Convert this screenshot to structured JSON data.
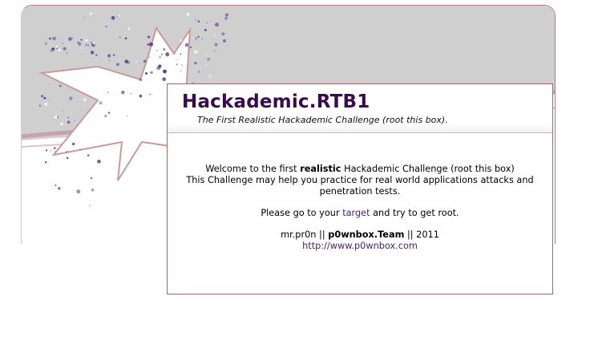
{
  "header": {
    "title": "Hackademic.RTB1",
    "subtitle": "The First Realistic Hackademic Challenge (root this box)."
  },
  "intro": {
    "line1_pre": "Welcome to the first ",
    "line1_bold": "realistic",
    "line1_post": " Hackademic Challenge (root this box)",
    "line2": "This Challenge may help you practice for real world applications attacks and",
    "line3": "penetration tests."
  },
  "instruction": {
    "pre": "Please go to your ",
    "link": "target",
    "post": " and try to get root."
  },
  "credits": {
    "author": "mr.pr0n",
    "sep1": " || ",
    "team": "p0wnbox.Team",
    "sep2": " || ",
    "year": "2011",
    "url": "http://www.p0wnbox.com"
  },
  "colors": {
    "title": "#3a0a4c",
    "link": "#4a1f6a",
    "banner_gray": "#cfcfcf",
    "swoosh": "#c99aa4",
    "stars": "#6b4aa0"
  }
}
